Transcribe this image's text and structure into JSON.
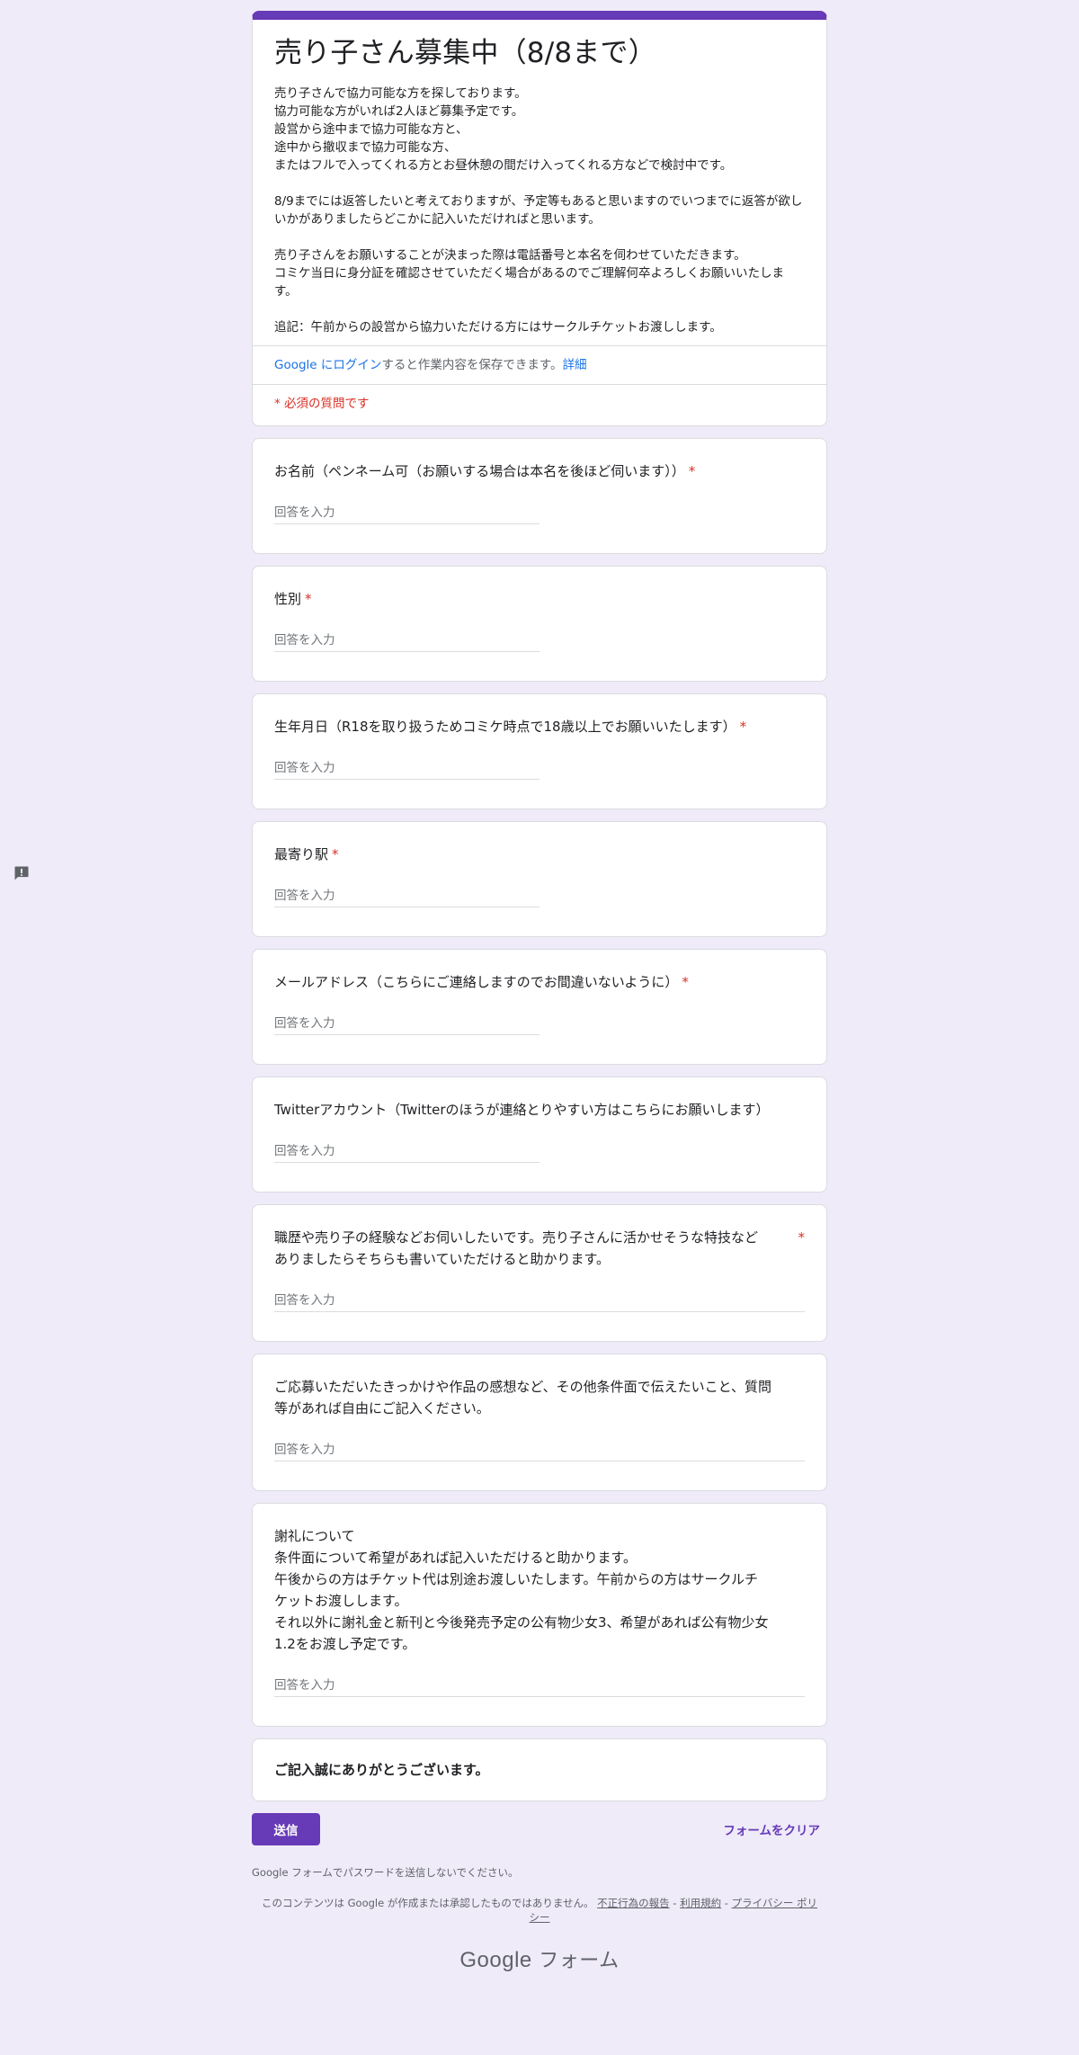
{
  "form": {
    "title": "売り子さん募集中（8/8まで）",
    "description": "売り子さんで協力可能な方を探しております。\n協力可能な方がいれば2人ほど募集予定です。\n設営から途中まで協力可能な方と、\n途中から撤収まで協力可能な方、\nまたはフルで入ってくれる方とお昼休憩の間だけ入ってくれる方などで検討中です。\n\n8/9までには返答したいと考えておりますが、予定等もあると思いますのでいつまでに返答が欲しいかがありましたらどこかに記入いただければと思います。\n\n売り子さんをお願いすることが決まった際は電話番号と本名を伺わせていただきます。\nコミケ当日に身分証を確認させていただく場合があるのでご理解何卒よろしくお願いいたします。\n\n追記：午前からの設営から協力いただける方にはサークルチケットお渡しします。",
    "login_link": "Google にログイン",
    "login_text": "すると作業内容を保存できます。",
    "login_detail": "詳細",
    "required_note": "* 必須の質問です"
  },
  "questions": [
    {
      "title": "お名前（ペンネーム可（お願いする場合は本名を後ほど伺います））",
      "required": "*",
      "placeholder": "回答を入力"
    },
    {
      "title": "性別",
      "required": "*",
      "placeholder": "回答を入力"
    },
    {
      "title": "生年月日（R18を取り扱うためコミケ時点で18歳以上でお願いいたします）",
      "required": "*",
      "placeholder": "回答を入力"
    },
    {
      "title": "最寄り駅",
      "required": "*",
      "placeholder": "回答を入力"
    },
    {
      "title": "メールアドレス（こちらにご連絡しますのでお間違いないように）",
      "required": "*",
      "placeholder": "回答を入力"
    },
    {
      "title": "Twitterアカウント（Twitterのほうが連絡とりやすい方はこちらにお願いします）",
      "required": "",
      "placeholder": "回答を入力"
    },
    {
      "title": "職歴や売り子の経験などお伺いしたいです。売り子さんに活かせそうな特技など\nありましたらそちらも書いていただけると助かります。",
      "required": "*",
      "placeholder": "回答を入力"
    },
    {
      "title": "ご応募いただいたきっかけや作品の感想など、その他条件面で伝えたいこと、質問\n等があれば自由にご記入ください。",
      "required": "",
      "placeholder": "回答を入力"
    },
    {
      "title": "謝礼について\n条件面について希望があれば記入いただけると助かります。\n午後からの方はチケット代は別途お渡しいたします。午前からの方はサークルチ\nケットお渡しします。\nそれ以外に謝礼金と新刊と今後発売予定の公有物少女3、希望があれば公有物少女\n1.2をお渡し予定です。",
      "required": "",
      "placeholder": "回答を入力"
    }
  ],
  "thanks": "ご記入誠にありがとうございます。",
  "actions": {
    "submit": "送信",
    "clear": "フォームをクリア"
  },
  "footer": {
    "password_warning": "Google フォームでパスワードを送信しないでください。",
    "disclaimer_prefix": "このコンテンツは Google が作成または承認したものではありません。",
    "report": "不正行為の報告",
    "sep1": " - ",
    "terms": "利用規約",
    "sep2": " - ",
    "privacy": "プライバシー ポリシー",
    "brand_google": "Google",
    "brand_forms": " フォーム"
  },
  "icons": {
    "feedback": "report-feedback-icon"
  },
  "colors": {
    "accent": "#673ab7",
    "background": "#efebf9",
    "required": "#d93025",
    "link": "#1a73e8"
  }
}
